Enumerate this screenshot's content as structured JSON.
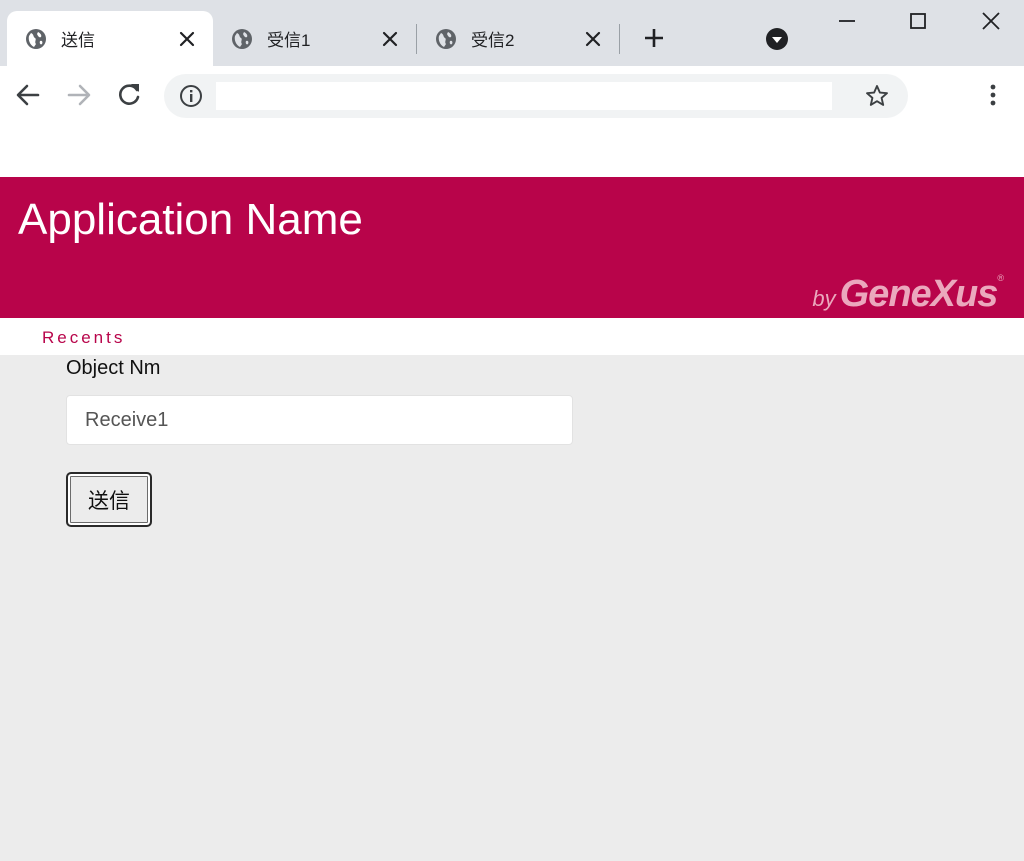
{
  "colors": {
    "brand": "#b8044a",
    "recents_link": "#b8044a"
  },
  "browser": {
    "tabs": [
      {
        "title": "送信",
        "active": true,
        "icon": "globe-icon"
      },
      {
        "title": "受信1",
        "active": false,
        "icon": "globe-icon"
      },
      {
        "title": "受信2",
        "active": false,
        "icon": "globe-icon"
      }
    ],
    "address_value": "",
    "icons": {
      "new_tab": "plus-icon",
      "tab_search": "tab-search-icon",
      "back": "arrow-left-icon",
      "forward": "arrow-right-icon",
      "reload": "reload-icon",
      "site_info": "info-icon",
      "bookmark": "star-icon",
      "menu": "kebab-menu-icon"
    }
  },
  "header": {
    "app_name": "Application Name",
    "brand_by": "by",
    "brand_name": "GeneXus",
    "brand_mark": "®"
  },
  "nav": {
    "recents": "Recents"
  },
  "form": {
    "object_label": "Object Nm",
    "object_value": "Receive1",
    "submit_label": "送信"
  }
}
